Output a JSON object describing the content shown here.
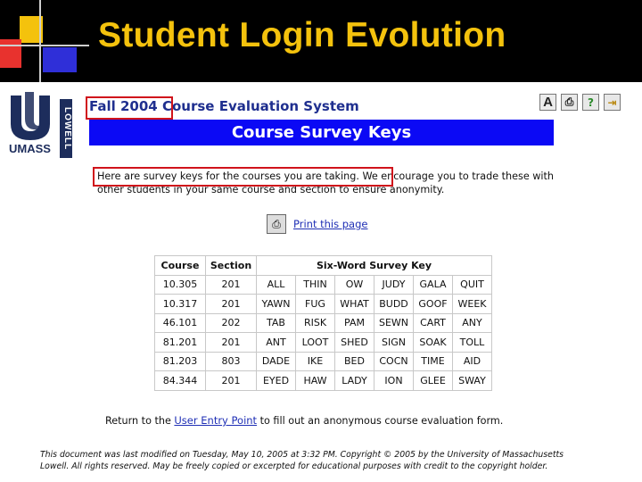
{
  "slide": {
    "title": "Student Login Evolution"
  },
  "logo": {
    "umass": "UMASS",
    "lowell": "LOWELL"
  },
  "header": {
    "semester": "Fall 2004",
    "system": "Course Evaluation System"
  },
  "toolbar": {
    "font_button": "A"
  },
  "banner": {
    "title": "Course Survey Keys"
  },
  "intro": {
    "highlighted": "Here are survey keys for the courses you are taking.",
    "rest": " We encourage you to trade these with other students in your same course and section to ensure anonymity."
  },
  "print": {
    "label": "Print this page"
  },
  "table": {
    "headers": [
      "Course",
      "Section",
      "Six-Word Survey Key"
    ],
    "rows": [
      {
        "course": "10.305",
        "section": "201",
        "words": [
          "ALL",
          "THIN",
          "OW",
          "JUDY",
          "GALA",
          "QUIT"
        ]
      },
      {
        "course": "10.317",
        "section": "201",
        "words": [
          "YAWN",
          "FUG",
          "WHAT",
          "BUDD",
          "GOOF",
          "WEEK"
        ]
      },
      {
        "course": "46.101",
        "section": "202",
        "words": [
          "TAB",
          "RISK",
          "PAM",
          "SEWN",
          "CART",
          "ANY"
        ]
      },
      {
        "course": "81.201",
        "section": "201",
        "words": [
          "ANT",
          "LOOT",
          "SHED",
          "SIGN",
          "SOAK",
          "TOLL"
        ]
      },
      {
        "course": "81.203",
        "section": "803",
        "words": [
          "DADE",
          "IKE",
          "BED",
          "COCN",
          "TIME",
          "AID"
        ]
      },
      {
        "course": "84.344",
        "section": "201",
        "words": [
          "EYED",
          "HAW",
          "LADY",
          "ION",
          "GLEE",
          "SWAY"
        ]
      }
    ]
  },
  "return": {
    "before": "Return to the ",
    "link": "User Entry Point",
    "after": " to fill out an anonymous course evaluation form."
  },
  "footer": {
    "text": "This document was last modified on Tuesday, May 10, 2005 at 3:32 PM. Copyright © 2005 by the University of Massachusetts Lowell. All rights reserved. May be freely copied or excerpted for educational purposes with credit to the copyright holder."
  },
  "colors": {
    "title_yellow": "#f4c20d",
    "banner_blue": "#0b09f5",
    "highlight_red": "#d0131b",
    "header_blue": "#1f2f8f"
  }
}
